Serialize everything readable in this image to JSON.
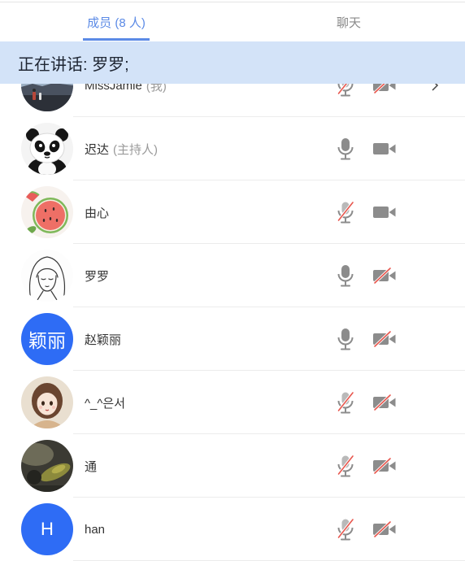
{
  "tabs": [
    {
      "label": "成员 (8 人)",
      "active": true
    },
    {
      "label": "聊天",
      "active": false
    }
  ],
  "speaking_banner": {
    "text": "正在讲话: 罗罗;"
  },
  "members": [
    {
      "name": "MissJamie",
      "tag": "(我)",
      "avatar": "landscape-photo",
      "mic_muted": true,
      "camera_muted": true,
      "has_chevron": true
    },
    {
      "name": "迟达",
      "tag": "(主持人)",
      "avatar": "panda-picture",
      "mic_muted": false,
      "camera_muted": false
    },
    {
      "name": "由心",
      "avatar": "watermelon-picture",
      "mic_muted": true,
      "camera_muted": false
    },
    {
      "name": "罗罗",
      "avatar": "line-drawing-girl",
      "mic_muted": false,
      "camera_muted": true
    },
    {
      "name": "赵颖丽",
      "avatar": "text-avatar",
      "avatar_text": "颖丽",
      "mic_muted": false,
      "camera_muted": true
    },
    {
      "name": "^_^은서",
      "avatar": "cartoon-girl",
      "mic_muted": true,
      "camera_muted": true
    },
    {
      "name": "通",
      "avatar": "dark-photo",
      "mic_muted": true,
      "camera_muted": true
    },
    {
      "name": "han",
      "avatar": "text-avatar",
      "avatar_text": "H",
      "mic_muted": true,
      "camera_muted": true
    }
  ],
  "icons": {
    "mic": "microphone-icon",
    "camera": "video-camera-icon",
    "chevron": "chevron-right-icon"
  },
  "colors": {
    "accent": "#5b8ae6",
    "tab_inactive": "#8a8a8a",
    "banner_bg": "#d3e3f8",
    "avatar_blue": "#2e6cf5",
    "icon_gray": "#8c8c8c",
    "muted_red": "#e8574e"
  }
}
